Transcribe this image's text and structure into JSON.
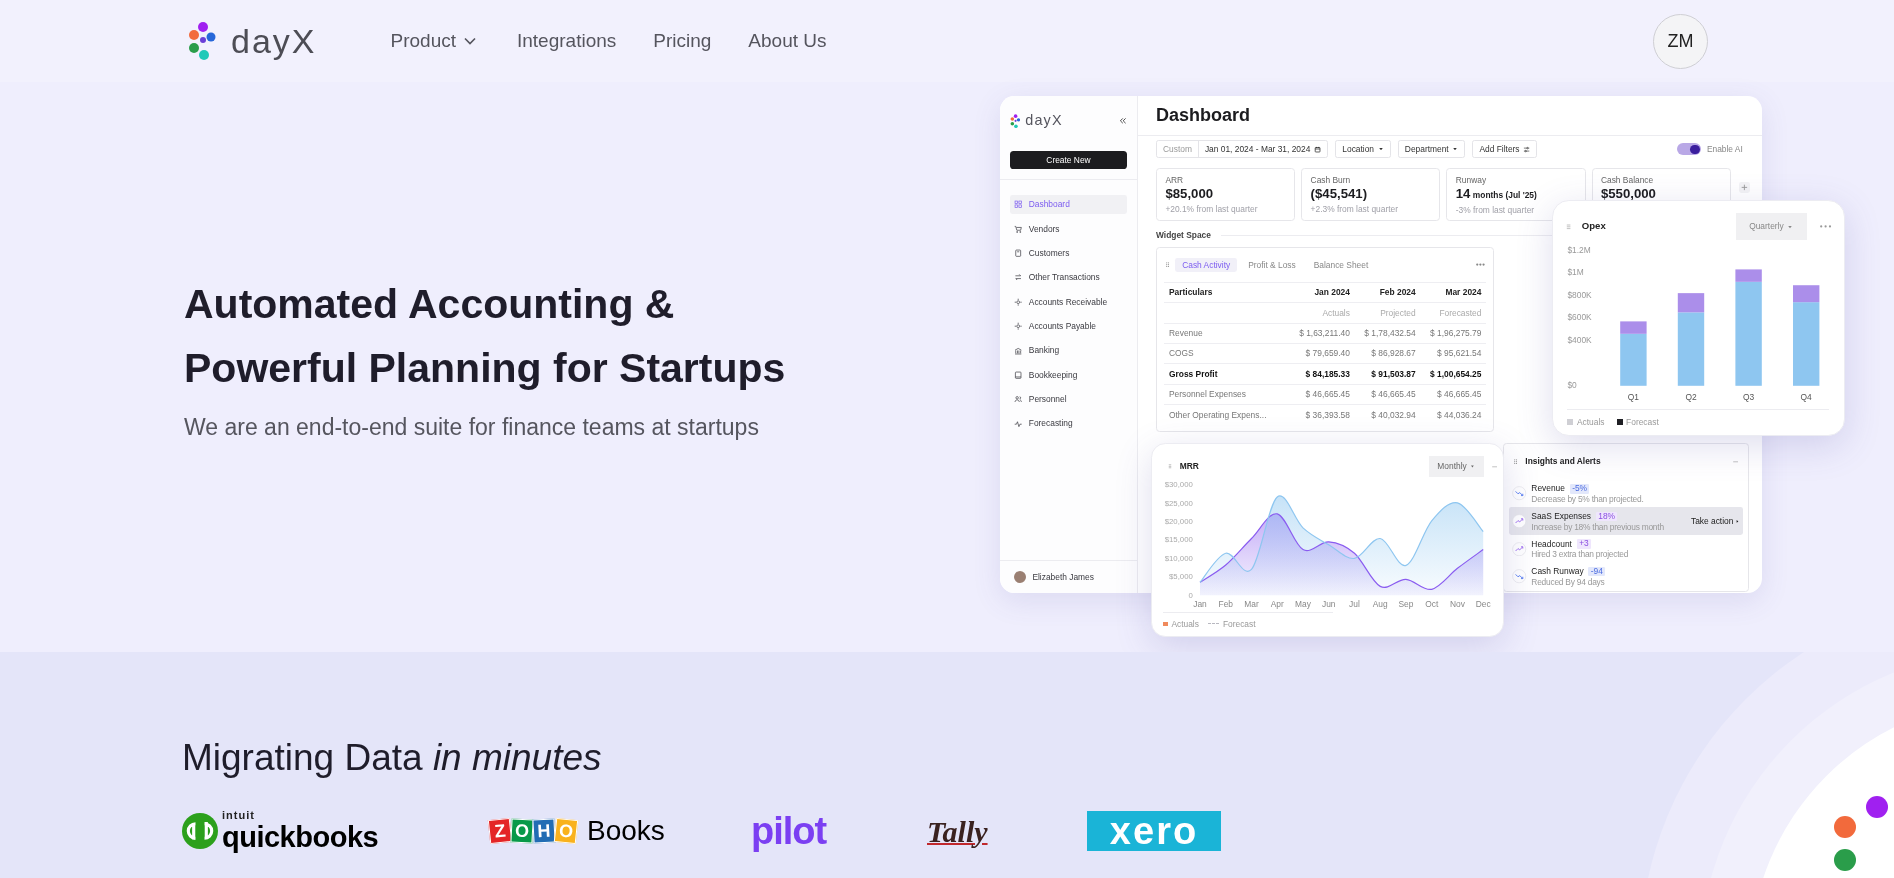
{
  "nav": {
    "logo": "dayX",
    "links": [
      {
        "label": "Product",
        "dropdown": true
      },
      {
        "label": "Integrations",
        "dropdown": false
      },
      {
        "label": "Pricing",
        "dropdown": false
      },
      {
        "label": "About Us",
        "dropdown": false
      }
    ],
    "avatar": "ZM"
  },
  "hero": {
    "title_lines": [
      "Automated Accounting &",
      "Powerful Planning for Startups"
    ],
    "subtitle": "We are an end-to-end suite for finance teams at startups"
  },
  "dashboard": {
    "sidebar": {
      "logo": "dayX",
      "create_button": "Create New",
      "items": [
        {
          "label": "Dashboard",
          "selected": true
        },
        {
          "label": "Vendors",
          "selected": false
        },
        {
          "label": "Customers",
          "selected": false
        },
        {
          "label": "Other Transactions",
          "selected": false
        },
        {
          "label": "Accounts Receivable",
          "selected": false
        },
        {
          "label": "Accounts Payable",
          "selected": false
        },
        {
          "label": "Banking",
          "selected": false
        },
        {
          "label": "Bookkeeping",
          "selected": false
        },
        {
          "label": "Personnel",
          "selected": false
        },
        {
          "label": "Forecasting",
          "selected": false
        }
      ],
      "user": "Elizabeth James"
    },
    "title": "Dashboard",
    "filters": {
      "range_label": "Custom",
      "date_range": "Jan 01, 2024 - Mar 31, 2024",
      "dropdowns": [
        "Location",
        "Department"
      ],
      "add_filters": "Add Filters",
      "ai_toggle": {
        "label": "Enable AI",
        "on": true
      }
    },
    "kpis": [
      {
        "label": "ARR",
        "value": "$85,000",
        "note": "+20.1% from last quarter"
      },
      {
        "label": "Cash Burn",
        "value": "($45,541)",
        "note": "+2.3% from last quarter"
      },
      {
        "label": "Runway",
        "value": "14",
        "unit": "months (Jul '25)",
        "note": "-3% from last quarter"
      },
      {
        "label": "Cash Balance",
        "value": "$550,000"
      }
    ],
    "widget_space": "Widget Space",
    "table_widget": {
      "tabs": [
        {
          "label": "Cash Activity",
          "selected": true
        },
        {
          "label": "Profit & Loss",
          "selected": false
        },
        {
          "label": "Balance Sheet",
          "selected": false
        }
      ],
      "columns": [
        "Particulars",
        "Jan 2024",
        "Feb 2024",
        "Mar 2024"
      ],
      "subheader": [
        "Actuals",
        "Projected",
        "Forecasted"
      ],
      "rows": [
        {
          "cells": [
            "Revenue",
            "$ 1,63,211.40",
            "$ 1,78,432.54",
            "$ 1,96,275.79"
          ],
          "bold": false
        },
        {
          "cells": [
            "COGS",
            "$ 79,659.40",
            "$ 86,928.67",
            "$ 95,621.54"
          ],
          "bold": false
        },
        {
          "cells": [
            "Gross Profit",
            "$ 84,185.33",
            "$ 91,503.87",
            "$ 1,00,654.25"
          ],
          "bold": true
        },
        {
          "cells": [
            "Personnel Expenses",
            "$ 46,665.45",
            "$ 46,665.45",
            "$ 46,665.45"
          ],
          "bold": false
        },
        {
          "cells": [
            "Other Operating Expens...",
            "$ 36,393.58",
            "$ 40,032.94",
            "$ 44,036.24"
          ],
          "bold": false
        }
      ]
    },
    "insights": {
      "title": "Insights and Alerts",
      "items": [
        {
          "title": "Revenue",
          "badge": "-5%",
          "detail": "Decrease by 5% than projected.",
          "rising": false,
          "highlighted": false
        },
        {
          "title": "SaaS Expenses",
          "badge": "18%",
          "detail": "Increase by 18% than previous month",
          "rising": true,
          "highlighted": true,
          "action": "Take action"
        },
        {
          "title": "Headcount",
          "badge": "+3",
          "detail": "Hired 3 extra than projected",
          "rising": true,
          "highlighted": false
        },
        {
          "title": "Cash Runway",
          "badge": "-94",
          "detail": "Reduced By 94 days",
          "rising": false,
          "highlighted": false
        }
      ]
    }
  },
  "opex": {
    "title": "Opex",
    "period": "Quarterly",
    "chart_data": {
      "type": "bar",
      "stacked": true,
      "categories": [
        "Q1",
        "Q2",
        "Q3",
        "Q4"
      ],
      "series": [
        {
          "name": "Actuals",
          "color": "#8ec6f0",
          "values": [
            460000,
            650000,
            920000,
            740000
          ]
        },
        {
          "name": "Forecast",
          "color": "#ab8eea",
          "values": [
            110000,
            170000,
            110000,
            150000
          ]
        }
      ],
      "ylim": [
        0,
        1200000
      ],
      "yticks": [
        {
          "value": 0,
          "label": "$0"
        },
        {
          "value": 400000,
          "label": "$400K"
        },
        {
          "value": 600000,
          "label": "$600K"
        },
        {
          "value": 800000,
          "label": "$800K"
        },
        {
          "value": 1000000,
          "label": "$1M"
        },
        {
          "value": 1200000,
          "label": "$1.2M"
        }
      ]
    }
  },
  "mrr": {
    "title": "MRR",
    "period": "Monthly",
    "chart_data": {
      "type": "area",
      "x": [
        "Jan",
        "Feb",
        "Mar",
        "Apr",
        "May",
        "Jun",
        "Jul",
        "Aug",
        "Sep",
        "Oct",
        "Nov",
        "Dec"
      ],
      "series": [
        {
          "name": "Actuals",
          "color": "#8a5cf0",
          "values": [
            3500,
            8200,
            15400,
            22100,
            12400,
            14500,
            11400,
            2400,
            4300,
            1600,
            7300,
            12400
          ]
        },
        {
          "name": "Forecast",
          "color": "#8ec6f0",
          "values": [
            3500,
            11400,
            7000,
            26700,
            18300,
            13700,
            10000,
            15400,
            8100,
            20200,
            25100,
            17300
          ]
        }
      ],
      "ylim": [
        0,
        30000
      ],
      "yticks": [
        {
          "value": 0,
          "label": "0"
        },
        {
          "value": 5000,
          "label": "$5,000"
        },
        {
          "value": 10000,
          "label": "$10,000"
        },
        {
          "value": 15000,
          "label": "$15,000"
        },
        {
          "value": 20000,
          "label": "$20,000"
        },
        {
          "value": 25000,
          "label": "$25,000"
        },
        {
          "value": 30000,
          "label": "$30,000"
        }
      ]
    }
  },
  "migrating": {
    "heading": "Migrating Data *in minutes*",
    "logos": [
      {
        "kind": "quickbooks",
        "brand": "intuit",
        "name": "quickbooks"
      },
      {
        "kind": "zoho",
        "letters": [
          "Z",
          "O",
          "H",
          "O"
        ],
        "name": "Books"
      },
      {
        "kind": "pilot",
        "name": "pilot"
      },
      {
        "kind": "tally",
        "name": "Tally"
      },
      {
        "kind": "xero",
        "name": "xero"
      }
    ]
  }
}
